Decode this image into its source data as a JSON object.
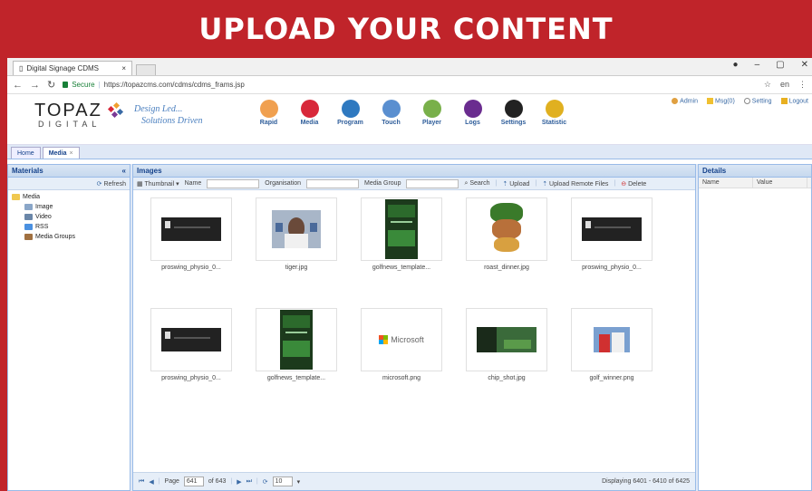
{
  "banner": {
    "title": "UPLOAD YOUR CONTENT"
  },
  "browser": {
    "tab_title": "Digital Signage CDMS",
    "secure_label": "Secure",
    "url": "https://topazcms.com/cdms/cdms_frams.jsp",
    "close_glyph": "×",
    "lang": "en"
  },
  "app": {
    "logo_top": "TOPAZ",
    "logo_bottom": "DIGITAL",
    "tagline_1": "Design Led...",
    "tagline_2": "Solutions Driven",
    "toolbar": [
      {
        "label": "Rapid",
        "color": "#f0a050",
        "icon": "rapid-icon"
      },
      {
        "label": "Media",
        "color": "#d8283a",
        "icon": "media-icon"
      },
      {
        "label": "Program",
        "color": "#2f79c0",
        "icon": "program-icon"
      },
      {
        "label": "Touch",
        "color": "#5a8fd0",
        "icon": "touch-icon"
      },
      {
        "label": "Player",
        "color": "#79b04a",
        "icon": "player-icon"
      },
      {
        "label": "Logs",
        "color": "#6a2c8f",
        "icon": "logs-icon"
      },
      {
        "label": "Settings",
        "color": "#222222",
        "icon": "settings-icon"
      },
      {
        "label": "Statistic",
        "color": "#e0b020",
        "icon": "statistic-icon"
      }
    ],
    "links": {
      "admin": "Admin",
      "msg": "Msg(0)",
      "setting": "Setting",
      "logout": "Logout"
    },
    "page_tabs": {
      "home": "Home",
      "media": "Media"
    }
  },
  "materials": {
    "title": "Materials",
    "refresh": "Refresh",
    "tree_root": "Media",
    "tree_children": [
      "Image",
      "Video",
      "RSS",
      "Media Groups"
    ]
  },
  "images": {
    "title": "Images",
    "view_mode": "Thumbnail",
    "name_label": "Name",
    "org_label": "Organisation",
    "group_label": "Media Group",
    "search": "Search",
    "upload": "Upload",
    "upload_remote": "Upload Remote Files",
    "delete": "Delete",
    "items": [
      {
        "caption": "proswing_physio_0...",
        "kind": "dark-banner"
      },
      {
        "caption": "tiger.jpg",
        "kind": "tiger"
      },
      {
        "caption": "golfnews_template...",
        "kind": "green-phone"
      },
      {
        "caption": "roast_dinner.jpg",
        "kind": "food"
      },
      {
        "caption": "proswing_physio_0...",
        "kind": "dark-banner"
      },
      {
        "caption": "proswing_physio_0...",
        "kind": "dark-banner"
      },
      {
        "caption": "golfnews_template...",
        "kind": "green-phone"
      },
      {
        "caption": "microsoft.png",
        "kind": "microsoft"
      },
      {
        "caption": "chip_shot.jpg",
        "kind": "chip"
      },
      {
        "caption": "golf_winner.png",
        "kind": "winner"
      }
    ],
    "microsoft_text": "Microsoft",
    "pager": {
      "page_label": "Page",
      "page_value": "641",
      "of_label": "of 643",
      "page_size": "10",
      "displaying": "Displaying 6401 - 6410 of 6425"
    }
  },
  "details": {
    "title": "Details",
    "col_name": "Name",
    "col_value": "Value"
  }
}
